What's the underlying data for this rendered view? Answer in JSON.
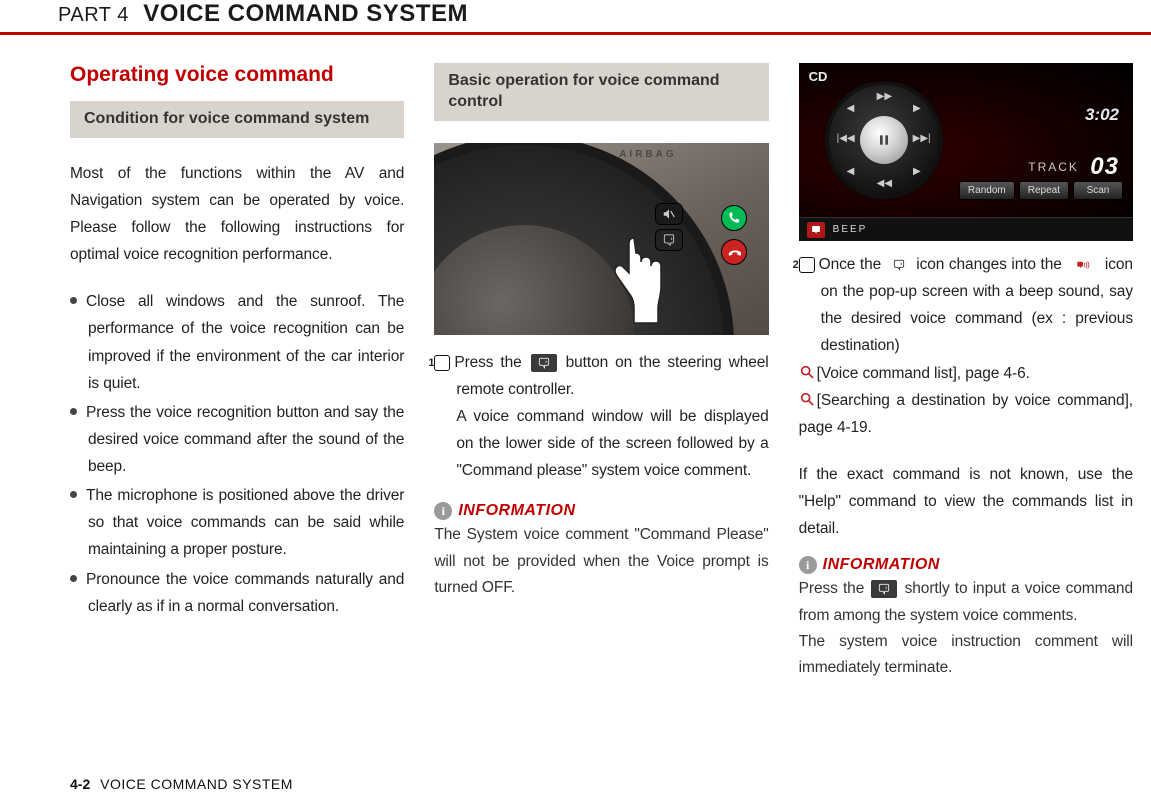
{
  "header": {
    "part": "PART 4",
    "title": "VOICE COMMAND SYSTEM"
  },
  "col1": {
    "heading": "Operating voice command",
    "subhead": "Condition for voice command system",
    "intro": "Most of the functions within the AV and Navigation system can be operated by voice. Please follow the following instructions for optimal voice recognition performance.",
    "bullets": [
      "Close all windows and the sunroof. The performance of the voice recognition can be improved if the environment of the car interior is quiet.",
      "Press the voice recognition button and say the desired voice command after the sound of the beep.",
      "The microphone is positioned above the driver so that voice commands can be said while maintaining a proper posture.",
      "Pronounce the voice commands naturally and clearly as if in a normal conversation."
    ]
  },
  "col2": {
    "subhead": "Basic operation for voice command control",
    "airbag_label": "AIRBAG",
    "step1_num": "1",
    "step1a": "Press the",
    "step1b": "button on the steering wheel remote controller.",
    "step1_cont": "A voice command window will be displayed on the lower side of the screen followed by a \"Command please\" system voice comment.",
    "info_label": "INFORMATION",
    "info_text": "The System voice comment \"Command Please\" will not be provided when the Voice prompt is turned OFF."
  },
  "col3": {
    "cd": {
      "cd_label": "CD",
      "time": "3:02",
      "track_label": "TRACK",
      "track_num": "03",
      "buttons": [
        "Random",
        "Repeat",
        "Scan"
      ],
      "beep": "BEEP"
    },
    "step2_num": "2",
    "step2a": "Once the",
    "step2b": "icon changes into the",
    "step2c": "icon on the pop-up screen with a beep sound, say the desired voice command (ex : previous destination)",
    "ref1": "[Voice command list], page 4-6.",
    "ref2": "[Searching a destination by voice command], page 4-19.",
    "help_para": "If the exact command is not known, use the \"Help\" command to view the commands list in detail.",
    "info_label": "INFORMATION",
    "info2a": "Press the",
    "info2b": "shortly to input a voice command from among the system voice comments.",
    "info2c": "The system voice instruction comment will immediately terminate."
  },
  "footer": {
    "page": "4-2",
    "name": "VOICE COMMAND SYSTEM"
  }
}
